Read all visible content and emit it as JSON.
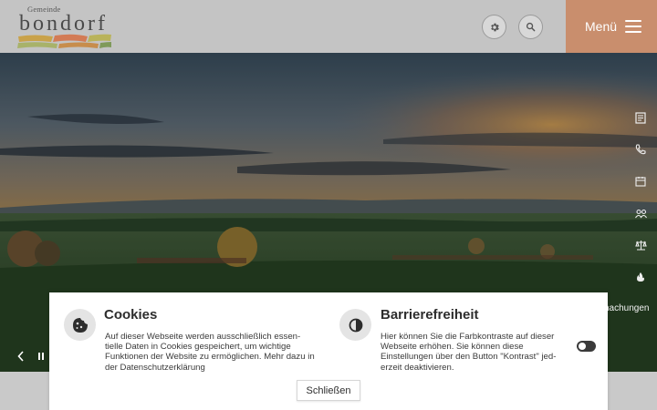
{
  "header": {
    "logo_sub": "Gemeinde",
    "logo_main": "bondorf",
    "menu_label": "Menü"
  },
  "icons": {
    "settings": "gear-icon",
    "search": "search-icon",
    "menu": "hamburger-icon",
    "side": [
      "news-icon",
      "phone-icon",
      "calendar-icon",
      "people-icon",
      "scales-icon",
      "fire-icon"
    ],
    "slider": [
      "chevron-left-icon",
      "pause-icon"
    ],
    "cookies": "cookie-icon",
    "accessibility": "contrast-icon"
  },
  "side": {
    "partial_label": "nachungen"
  },
  "dialog": {
    "cookies_title": "Cookies",
    "cookies_text": "Auf dieser Webseite werden ausschließlich essen­tielle Daten in Cookies gespeichert, um wichtige Funktionen der Website zu ermöglichen. Mehr dazu in der Datenschutzerklärung",
    "access_title": "Barrierefreiheit",
    "access_text": "Hier können Sie die Farbkontraste auf dieser Webseite erhöhen. Sie können diese Einstellungen über den Button \"Kontrast\" jed­erzeit deaktivieren.",
    "contrast_toggle_on": false,
    "close_label": "Schließen"
  },
  "colors": {
    "accent": "#c98e6d",
    "header_bg": "#c4c4c4"
  }
}
